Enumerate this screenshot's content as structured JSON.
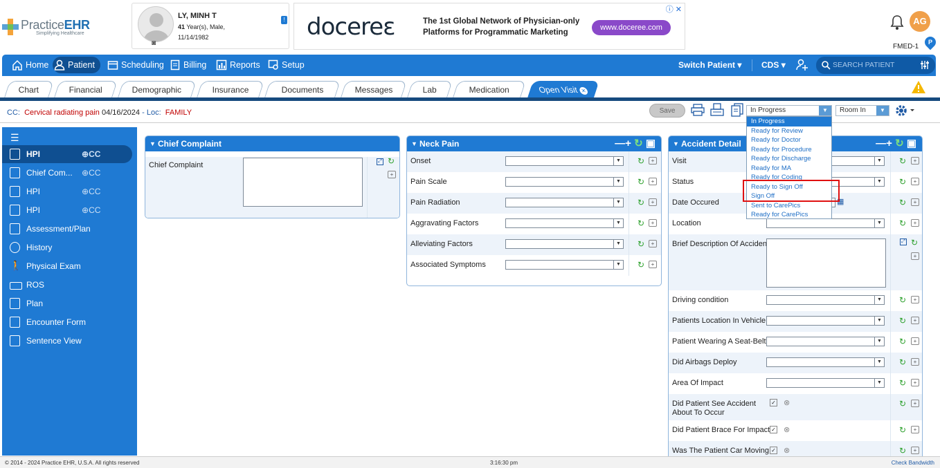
{
  "app": {
    "brand_a": "Practice",
    "brand_b": "EHR",
    "tagline": "Simplifying Healthcare"
  },
  "patient": {
    "name": "LY, MINH T",
    "age": "41",
    "age_suffix": "Year(s), Male,",
    "dob": "11/14/1982"
  },
  "ad": {
    "logo": "docereε",
    "line1": "The 1st Global Network of Physician-only",
    "line2": "Platforms for Programmatic Marketing",
    "cta": "www.doceree.com"
  },
  "user": {
    "initials": "AG",
    "location": "FMED-1"
  },
  "nav": {
    "home": "Home",
    "patient": "Patient",
    "scheduling": "Scheduling",
    "billing": "Billing",
    "reports": "Reports",
    "setup": "Setup",
    "switch_patient": "Switch Patient",
    "cds": "CDS",
    "search_placeholder": "SEARCH PATIENT"
  },
  "tabs": [
    "Chart",
    "Financial",
    "Demographic",
    "Insurance",
    "Documents",
    "Messages",
    "Lab",
    "Medication",
    "Open Visit"
  ],
  "cc_bar": {
    "cc_label": "CC:",
    "cc_value": "Cervical radiating pain",
    "date": "04/16/2024",
    "loc_label": "- Loc:",
    "loc_value": "FAMILY"
  },
  "toolbar": {
    "save": "Save",
    "status_selected": "In Progress",
    "room_selected": "Room In"
  },
  "status_options": [
    "In Progress",
    "Ready for Review",
    "Ready for Doctor",
    "Ready for Procedure",
    "Ready for Discharge",
    "Ready for MA",
    "Ready for Coding",
    "Ready to Sign Off",
    "Sign Off",
    "Sent to CarePics",
    "Ready for CarePics"
  ],
  "sidebar": [
    {
      "label": "HPI",
      "cc": "CC"
    },
    {
      "label": "Chief Com...",
      "cc": "CC"
    },
    {
      "label": "HPI",
      "cc": "CC"
    },
    {
      "label": "HPI",
      "cc": "CC"
    },
    {
      "label": "Assessment/Plan"
    },
    {
      "label": "History"
    },
    {
      "label": "Physical Exam"
    },
    {
      "label": "ROS"
    },
    {
      "label": "Plan"
    },
    {
      "label": "Encounter Form"
    },
    {
      "label": "Sentence View"
    }
  ],
  "chief_complaint": {
    "title": "Chief Complaint",
    "field_label": "Chief Complaint"
  },
  "neck_pain": {
    "title": "Neck Pain",
    "fields": [
      "Onset",
      "Pain Scale",
      "Pain Radiation",
      "Aggravating Factors",
      "Alleviating Factors",
      "Associated Symptoms"
    ]
  },
  "accident": {
    "title": "Accident Detail",
    "fields": [
      "Visit",
      "Status",
      "Date Occured",
      "Location",
      "Brief Description Of Accident",
      "Driving condition",
      "Patients Location In Vehicle",
      "Patient Wearing A Seat-Belt",
      "Did Airbags Deploy",
      "Area Of Impact",
      "Did Patient See Accident About To Occur",
      "Did Patient Brace For Impact",
      "Was The Patient Car Moving"
    ]
  },
  "footer": {
    "copyright": "© 2014 - 2024 Practice EHR, U.S.A. All rights reserved",
    "time": "3:16:30 pm",
    "bandwidth": "Check Bandwidth"
  }
}
